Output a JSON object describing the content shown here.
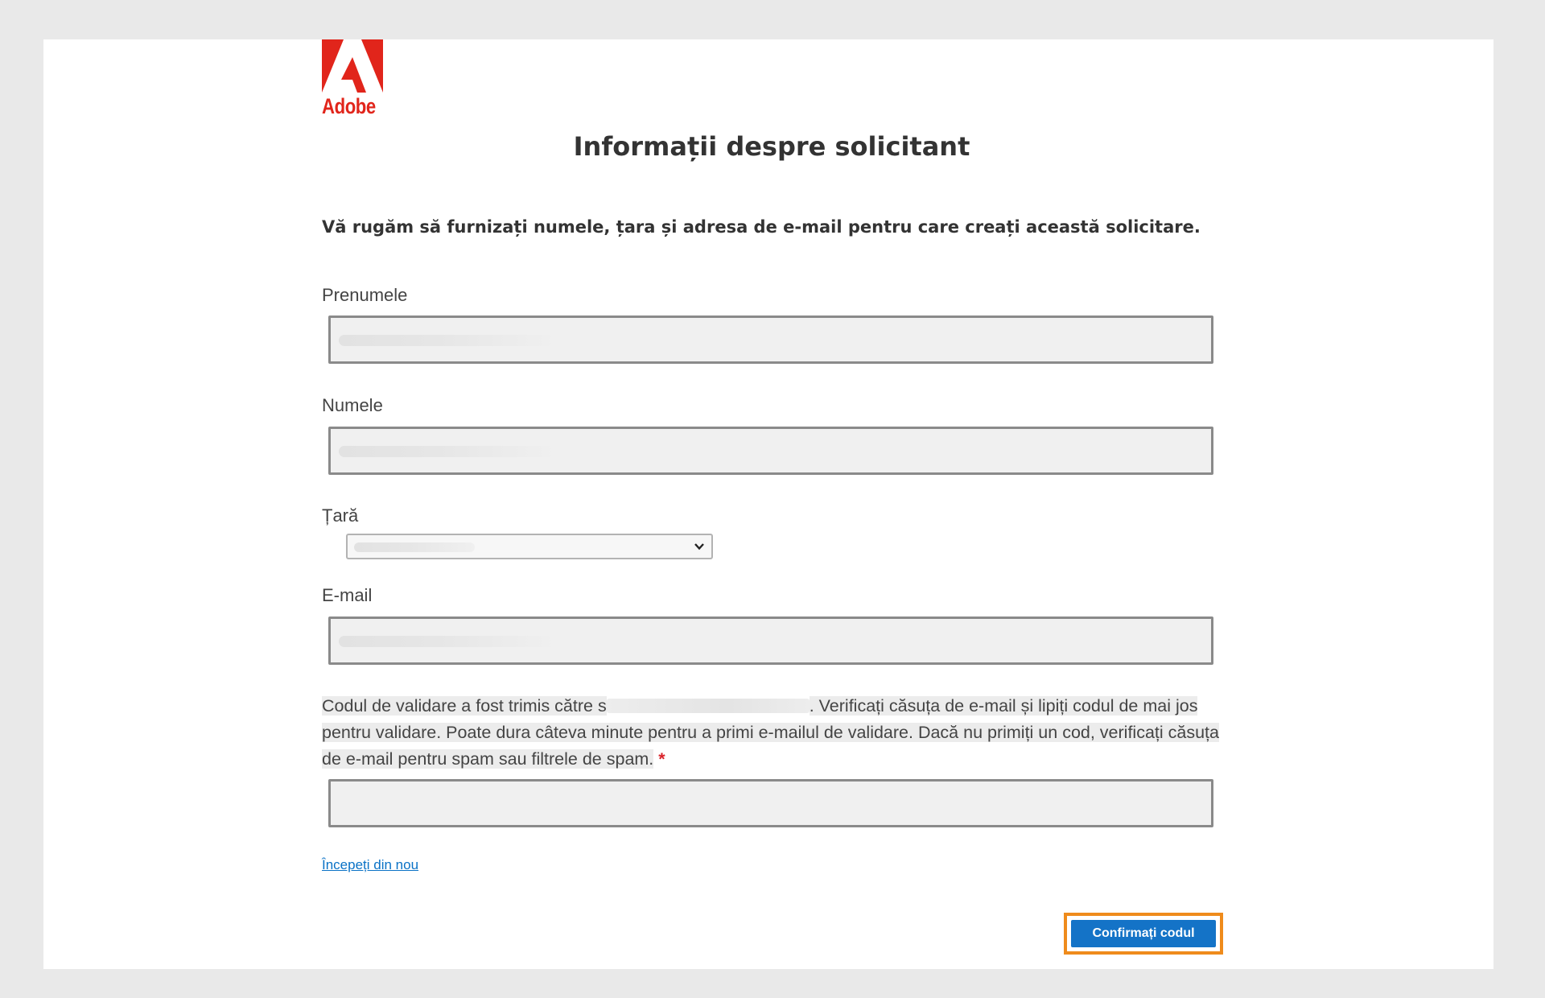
{
  "brand": {
    "logo_text": "Adobe",
    "color": "#e1251b"
  },
  "heading": {
    "title": "Informații despre solicitant",
    "intro": "Vă rugăm să furnizați numele, țara și adresa de e-mail pentru care creați această solicitare."
  },
  "form": {
    "first_name": {
      "label": "Prenumele",
      "value": ""
    },
    "last_name": {
      "label": "Numele",
      "value": ""
    },
    "country": {
      "label": "Țară",
      "selected": "",
      "icon": "chevron-down-icon"
    },
    "email": {
      "label": "E-mail",
      "value": ""
    },
    "validation": {
      "text_before": "Codul de validare a fost trimis către ",
      "text_partial": "s",
      "text_after": ". Verificați căsuța de e-mail și lipiți codul de mai jos pentru validare. Poate dura câteva minute pentru a primi e-mailul de validare. Dacă nu primiți un cod, verificați căsuța de e-mail pentru spam sau filtrele de spam.",
      "required_marker": "*",
      "code_value": ""
    }
  },
  "actions": {
    "restart_link": "Începeți din nou",
    "confirm_button": "Confirmați codul",
    "confirm_color": "#1473c7",
    "highlight_color": "#ef8b1c"
  }
}
